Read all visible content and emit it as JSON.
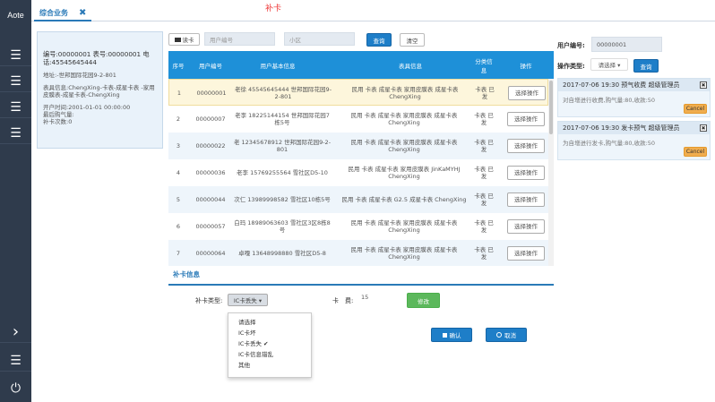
{
  "nav": {
    "brand": "Aote",
    "menu_glyph": "☰",
    "expand_glyph": "›",
    "power_glyph": "⏻"
  },
  "tab": {
    "label": "综合业务",
    "close": "✖"
  },
  "page_title": "补卡",
  "user_card": {
    "id_line": "编号:00000001 表号:00000001 电话:45545645444",
    "address": "地址:-世邦国际花园9-2-801",
    "meter": "表具信息:ChengXing-卡表-成星卡表 -家用皮膜表-成星卡表-ChengXing",
    "open_time": "开户时间:2001-01-01 00:00:00",
    "last_buy": "最后购气量:",
    "card_count": "补卡次数:0"
  },
  "search": {
    "read_card": "读卡",
    "user_no_placeholder": "用户编号",
    "area_placeholder": "小区",
    "query": "查询",
    "clear": "清空"
  },
  "table": {
    "headers": {
      "seq": "序号",
      "user_no": "用户编号",
      "basic": "用户基本信息",
      "meter": "表具信息",
      "category": "分类信息",
      "op": "操作"
    },
    "rows": [
      {
        "seq": "1",
        "no": "00000001",
        "basic": "老徐  45545645444  世邦国际花园9-2-801",
        "meter": "民用  卡表  成星卡表  家用皮膜表  成星卡表  ChengXing",
        "category": "卡表  已发",
        "op": "选择操作"
      },
      {
        "seq": "2",
        "no": "00000007",
        "basic": "老李  18225144154  世邦国际花园7栋5号",
        "meter": "民用  卡表  成星卡表  家用皮膜表  成星卡表  ChengXing",
        "category": "卡表  已发",
        "op": "选择操作"
      },
      {
        "seq": "3",
        "no": "00000022",
        "basic": "老  12345678912  世邦国际花园9-2-801",
        "meter": "民用  卡表  成星卡表  家用皮膜表  成星卡表  ChengXing",
        "category": "卡表  已发",
        "op": "选择操作"
      },
      {
        "seq": "4",
        "no": "00000036",
        "basic": "老李  15769255564  雪社区D5-10",
        "meter": "民用  卡表  成星卡表  家用皮膜表  JinKaMYHJ  ChengXing",
        "category": "卡表  已发",
        "op": "选择操作"
      },
      {
        "seq": "5",
        "no": "00000044",
        "basic": "次仁  13989998582  雪社区10栋5号",
        "meter": "民用  卡表  成星卡表  G2.5  成星卡表  ChengXing",
        "category": "卡表  已发",
        "op": "选择操作"
      },
      {
        "seq": "6",
        "no": "00000057",
        "basic": "白玛  18989063603  雪社区3区8栋8号",
        "meter": "民用  卡表  成星卡表  家用皮膜表  成星卡表  ChengXing",
        "category": "卡表  已发",
        "op": "选择操作"
      },
      {
        "seq": "7",
        "no": "00000064",
        "basic": "卓嘎  13648998880  雪社区D5-8",
        "meter": "民用  卡表  成星卡表  家用皮膜表  成星卡表  ChengXing",
        "category": "卡表  已发",
        "op": "选择操作"
      }
    ]
  },
  "reissue": {
    "section": "补卡信息",
    "type_label": "补卡类型:",
    "type_value": "IC卡丢失 ▾",
    "fee_label": "卡　费:",
    "fee_value": "15",
    "modify": "修改",
    "confirm": "确认",
    "cancel": "取消",
    "options": [
      "请选择",
      "IC卡坏",
      "IC卡丢失 ✔",
      "IC卡信息错乱",
      "其他"
    ]
  },
  "right": {
    "user_no_label": "用户编号:",
    "user_no_value": "00000001",
    "op_type_label": "操作类型:",
    "op_type_value": "请选择 ▾",
    "query": "查询",
    "messages": [
      {
        "title": "2017-07-06 19:30  预气收费  超级管理员",
        "body": "对自增进行收费,购气量:80,收款:50",
        "cancel": "Cancel"
      },
      {
        "title": "2017-07-06 19:30  发卡预气  超级管理员",
        "body": "为自增进行发卡,购气量:80,收款:50",
        "cancel": "Cancel"
      }
    ]
  },
  "colors": {
    "nav": "#2f3b4c",
    "accent": "#1e90d8",
    "title_red": "#ee3333"
  }
}
